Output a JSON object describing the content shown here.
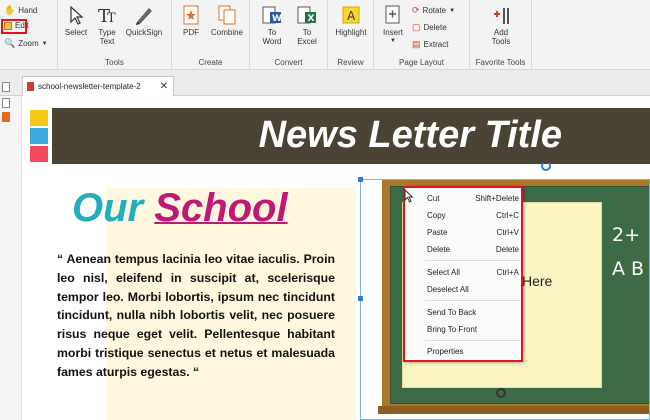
{
  "ribbon": {
    "hand": "Hand",
    "edit": "Edit",
    "zoom": "Zoom",
    "groups": {
      "tools": {
        "label": "Tools",
        "select": "Select",
        "type_text": "Type Text",
        "quicksign": "QuickSign"
      },
      "create": {
        "label": "Create",
        "pdf": "PDF",
        "combine": "Combine"
      },
      "convert": {
        "label": "Convert",
        "to_word": "To Word",
        "to_excel": "To Excel"
      },
      "review": {
        "label": "Review",
        "highlight": "Highlight"
      },
      "page_layout": {
        "label": "Page Layout",
        "insert": "Insert",
        "rotate": "Rotate",
        "delete": "Delete",
        "extract": "Extract"
      },
      "favorite": {
        "label": "Favorite Tools",
        "add_tools": "Add Tools"
      }
    }
  },
  "tab": {
    "title": "school-newsletter-template-2",
    "close": "✕"
  },
  "document": {
    "banner_title": "News Letter Title",
    "our": "Our",
    "school": "School",
    "paragraph": "“ Aenean tempus lacinia leo vitae iaculis. Proin leo nisl, eleifend in suscipit at, scelerisque tempor leo. Morbi lobortis, ipsum nec tincidunt tincidunt, nulla nibh lobortis velit, nec posuere risus neque eget velit. Pellentesque habitant morbi tristique senectus et netus et malesuada fames aturpis egestas. “",
    "board_text": "Here",
    "board_math_1": "2+",
    "board_math_2": "A B",
    "swatch_colors": [
      "#f5c518",
      "#39a9dc",
      "#ef4b5c"
    ]
  },
  "context_menu": {
    "items": [
      {
        "label": "Cut",
        "shortcut": "Shift+Delete"
      },
      {
        "label": "Copy",
        "shortcut": "Ctrl+C"
      },
      {
        "label": "Paste",
        "shortcut": "Ctrl+V"
      },
      {
        "label": "Delete",
        "shortcut": "Delete"
      },
      {
        "label": "Select All",
        "shortcut": "Ctrl+A"
      },
      {
        "label": "Deselect All",
        "shortcut": ""
      },
      {
        "label": "Send To Back",
        "shortcut": ""
      },
      {
        "label": "Bring To Front",
        "shortcut": ""
      },
      {
        "label": "Properties",
        "shortcut": ""
      }
    ]
  },
  "colors": {
    "highlight_border": "#e0141e",
    "banner_bg": "#4a4232",
    "our_color": "#22aebd",
    "school_color": "#c01875"
  }
}
